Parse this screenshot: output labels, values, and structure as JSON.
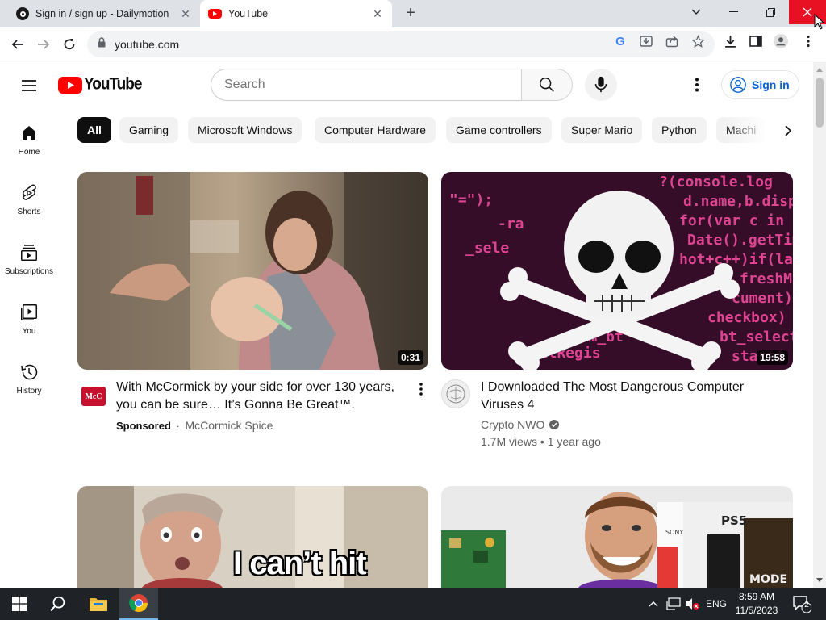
{
  "browser": {
    "tabs": [
      {
        "title": "Sign in / sign up - Dailymotion",
        "active": false
      },
      {
        "title": "YouTube",
        "active": true
      }
    ],
    "url": "youtube.com",
    "window_controls": {
      "minimize": "—",
      "maximize": "❐",
      "close": "✕"
    }
  },
  "header": {
    "logo_text": "YouTube",
    "search_placeholder": "Search",
    "signin_label": "Sign in"
  },
  "sidebar": {
    "items": [
      {
        "label": "Home",
        "icon": "home-icon"
      },
      {
        "label": "Shorts",
        "icon": "shorts-icon"
      },
      {
        "label": "Subscriptions",
        "icon": "subscriptions-icon"
      },
      {
        "label": "You",
        "icon": "you-icon"
      },
      {
        "label": "History",
        "icon": "history-icon"
      }
    ]
  },
  "chips": [
    "All",
    "Gaming",
    "Microsoft Windows",
    "Computer Hardware",
    "Game controllers",
    "Super Mario",
    "Python",
    "Machi"
  ],
  "videos": [
    {
      "title_line1": "With McCormick by your side for over 130 years,",
      "title_line2": "you can be sure… It’s Gonna Be Great™.",
      "duration": "0:31",
      "sponsored": "Sponsored",
      "channel": "McCormick Spice",
      "avatar_text": "McC"
    },
    {
      "title_line1": "I Downloaded The Most Dangerous Computer",
      "title_line2": "Viruses 4",
      "duration": "19:58",
      "channel": "Crypto NWO",
      "stats": "1.7M views • 1 year ago"
    },
    {
      "thumb_caption": "I can’t hit"
    },
    {
      "thumb_brand": "PS5"
    }
  ],
  "thumb_text": {
    "code_lines": [
      "?(console.log",
      "d.name,b.display",
      "for(var c in b)",
      "Date().getTime",
      "hot+c++)if(la[",
      "freshM",
      "cument)",
      "checkbox)",
      "bt_select",
      "start(",
      "\"=\"); ",
      "-ra",
      "_sele",
      "eAllRegis",
      "stom_bt"
    ],
    "ps_brand": "SONY",
    "game_title": "MODE"
  },
  "taskbar": {
    "time": "8:59 AM",
    "date": "11/5/2023",
    "lang": "ENG",
    "notif_count": "2"
  },
  "colors": {
    "yt_red": "#ff0000",
    "link_blue": "#065fd4",
    "chrome_tabbar": "#dee1e6",
    "taskbar": "#1f2328",
    "close_red": "#e81123"
  }
}
